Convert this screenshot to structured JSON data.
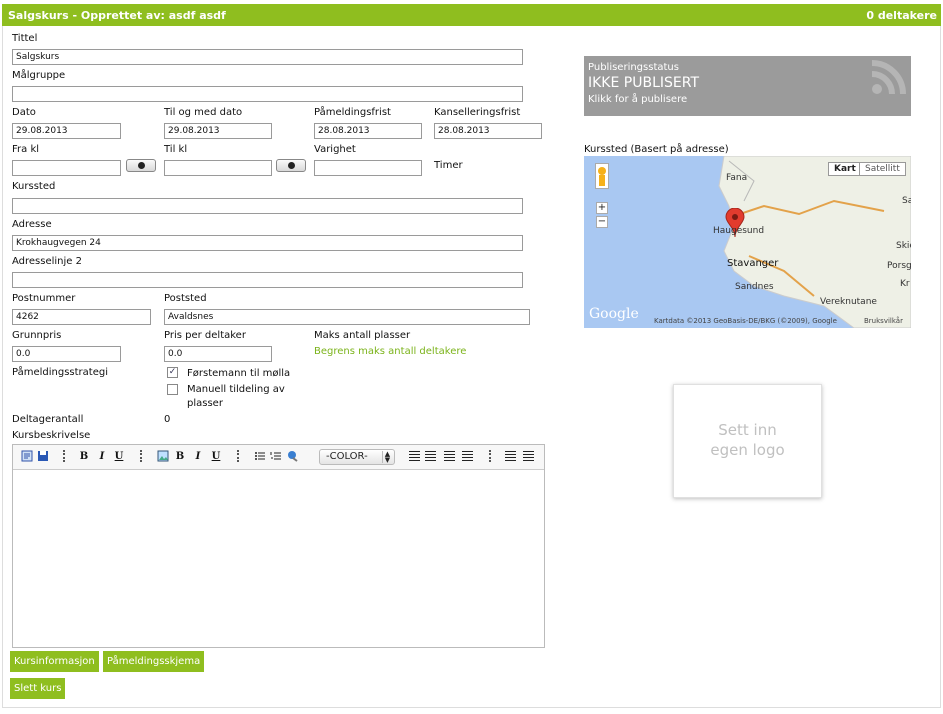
{
  "header": {
    "title": "Salgskurs - Opprettet av: asdf asdf",
    "participants": "0 deltakere"
  },
  "form": {
    "title_label": "Tittel",
    "title_value": "Salgskurs",
    "target_label": "Målgruppe",
    "target_value": "",
    "date_label": "Dato",
    "date_value": "29.08.2013",
    "to_date_label": "Til og med dato",
    "to_date_value": "29.08.2013",
    "signup_deadline_label": "Påmeldingsfrist",
    "signup_deadline_value": "28.08.2013",
    "cancel_deadline_label": "Kanselleringsfrist",
    "cancel_deadline_value": "28.08.2013",
    "from_time_label": "Fra kl",
    "from_time_value": "",
    "to_time_label": "Til kl",
    "to_time_value": "",
    "duration_label": "Varighet",
    "duration_value": "",
    "duration_unit": "Timer",
    "venue_label": "Kurssted",
    "venue_value": "",
    "address_label": "Adresse",
    "address_value": "Krokhaugvegen 24",
    "address2_label": "Adresselinje 2",
    "address2_value": "",
    "postcode_label": "Postnummer",
    "postcode_value": "4262",
    "city_label": "Poststed",
    "city_value": "Avaldsnes",
    "base_price_label": "Grunnpris",
    "base_price_value": "0.0",
    "price_per_label": "Pris per deltaker",
    "price_per_value": "0.0",
    "max_places_label": "Maks antall plasser",
    "max_places_link": "Begrens maks antall deltakere",
    "strategy_label": "Påmeldingsstrategi",
    "strategy_options": [
      {
        "label": "Førstemann til mølla",
        "checked": true
      },
      {
        "label_line1": "Manuell tildeling av",
        "label_line2": "plasser",
        "checked": false
      }
    ],
    "participant_count_label": "Deltagerantall",
    "participant_count_value": "0",
    "description_label": "Kursbeskrivelse"
  },
  "editor": {
    "color_select": "-COLOR-",
    "bold": "B",
    "italic": "I",
    "underline": "U"
  },
  "buttons": {
    "course_info": "Kursinformasjon",
    "signup_form": "Påmeldingsskjema",
    "delete_course": "Slett kurs"
  },
  "publish": {
    "status_label": "Publiseringsstatus",
    "status_value": "IKKE PUBLISERT",
    "action": "Klikk for å publisere"
  },
  "map": {
    "title": "Kurssted (Basert på adresse)",
    "map_button": "Kart",
    "satellite_button": "Satellitt",
    "places": [
      "Fana",
      "Haugesund",
      "Stavanger",
      "Sandnes",
      "Vereknutane",
      "Skie",
      "Porsgr",
      "Sa",
      "Kr"
    ],
    "attribution": "Kartdata ©2013 GeoBasis-DE/BKG (©2009), Google",
    "terms": "Bruksvilkår",
    "brand": "Google"
  },
  "logo": {
    "line1": "Sett inn",
    "line2": "egen logo"
  },
  "colors": {
    "accent": "#8fbe1f",
    "publish_bg": "#9b9b9b",
    "link": "#7bb31a"
  },
  "icons": [
    "clock-icon",
    "rss-icon",
    "pegman-icon",
    "map-pin-icon",
    "save-icon",
    "image-icon",
    "list-icon",
    "align-icon",
    "indent-icon"
  ]
}
